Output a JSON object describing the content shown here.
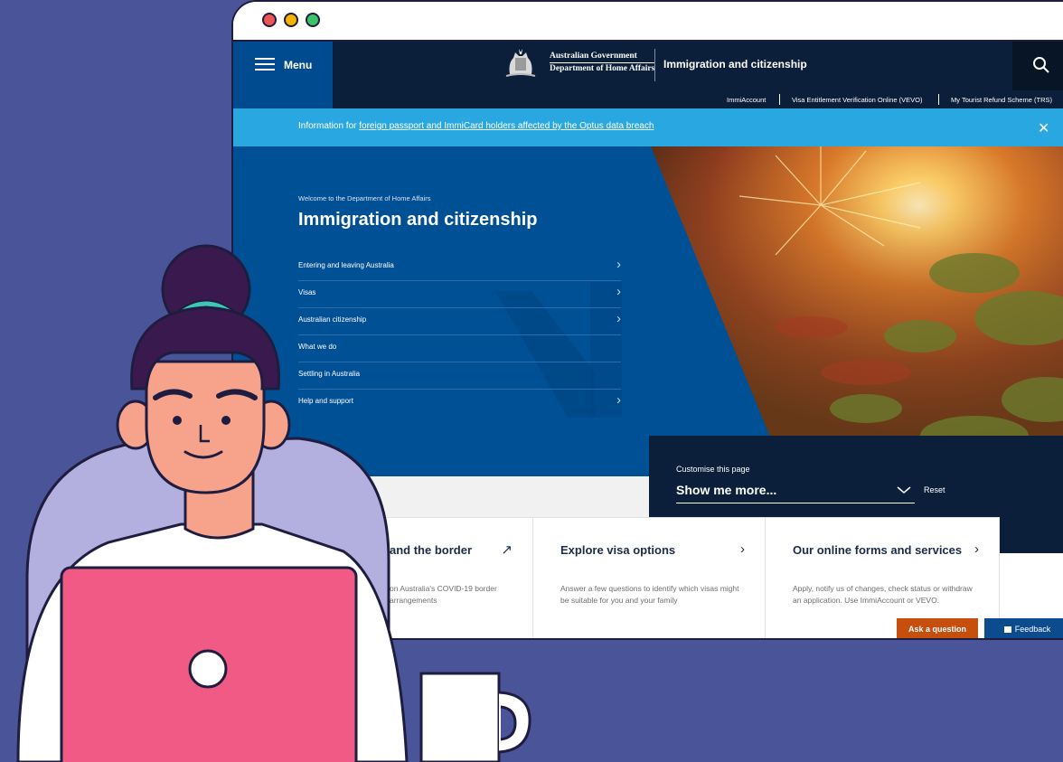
{
  "colors": {
    "background": "#4a5499",
    "header_navy": "#0c1f3a",
    "hero_blue": "#005096",
    "alert_blue": "#29a7e1",
    "ask_orange": "#c74f0e",
    "feedback_blue": "#0c4c8e",
    "laptop_pink": "#f25a86"
  },
  "window": {
    "dot_colors": [
      "#ee5454",
      "#f4b400",
      "#3cc36a"
    ]
  },
  "header": {
    "menu_label": "Menu",
    "gov_line1": "Australian Government",
    "gov_line2": "Department of Home Affairs",
    "title": "Immigration and citizenship",
    "search_icon": "search-icon"
  },
  "subnav": {
    "links": [
      "ImmiAccount",
      "Visa Entitlement Verification Online (VEVO)",
      "My Tourist Refund Scheme (TRS)"
    ]
  },
  "alert": {
    "prefix": "Information for ",
    "link": "foreign passport and ImmiCard holders affected by the Optus data breach",
    "close": "✕"
  },
  "hero": {
    "welcome": "Welcome to the Department of Home Affairs",
    "title": "Immigration and citizenship",
    "nav": [
      {
        "label": "Entering and leaving Australia",
        "chevron": "›"
      },
      {
        "label": "Visas",
        "chevron": "›"
      },
      {
        "label": "Australian citizenship",
        "chevron": "›"
      },
      {
        "label": "What we do",
        "chevron": ""
      },
      {
        "label": "Settling in Australia",
        "chevron": ""
      },
      {
        "label": "Help and support",
        "chevron": "›"
      }
    ]
  },
  "customise": {
    "label": "Customise this page",
    "select_value": "Show me more...",
    "reset": "Reset"
  },
  "cards": [
    {
      "title": "and the border",
      "arrow": "↗",
      "desc": "on Australia's COVID-19 border arrangements"
    },
    {
      "title": "Explore visa options",
      "arrow": "›",
      "desc": "Answer a few questions to identify which visas might be suitable for you and your family"
    },
    {
      "title": "Our online forms and services",
      "arrow": "›",
      "desc": "Apply, notify us of changes, check status or withdraw an application. Use ImmiAccount or VEVO."
    }
  ],
  "buttons": {
    "ask": "Ask a question",
    "feedback": "Feedback"
  }
}
